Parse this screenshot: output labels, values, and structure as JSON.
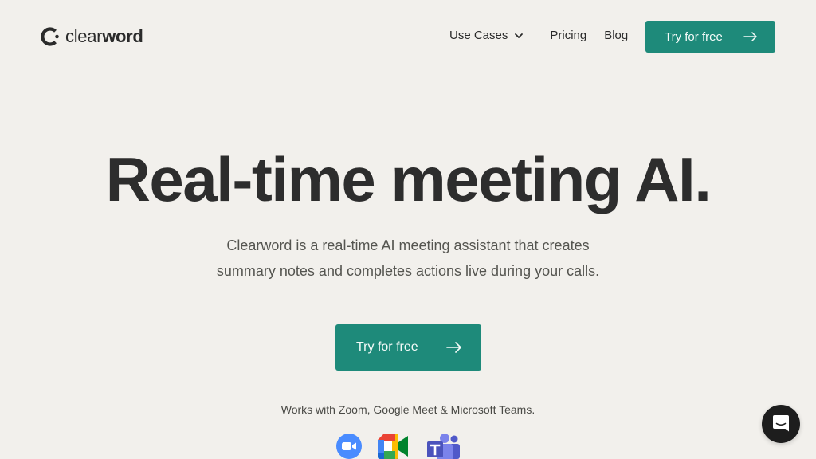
{
  "brand": {
    "name_light": "clear",
    "name_bold": "word",
    "accent": "#1e8a7a"
  },
  "nav": {
    "use_cases": "Use Cases",
    "pricing": "Pricing",
    "blog": "Blog",
    "cta": "Try for free"
  },
  "hero": {
    "title": "Real-time meeting AI.",
    "subtitle": "Clearword is a real-time AI meeting assistant that creates summary notes and completes actions live during your calls.",
    "cta": "Try for free",
    "works_with": "Works with Zoom, Google Meet & Microsoft Teams."
  },
  "platforms": [
    "zoom-icon",
    "google-meet-icon",
    "microsoft-teams-icon"
  ],
  "chat": {
    "icon": "chat-icon"
  }
}
